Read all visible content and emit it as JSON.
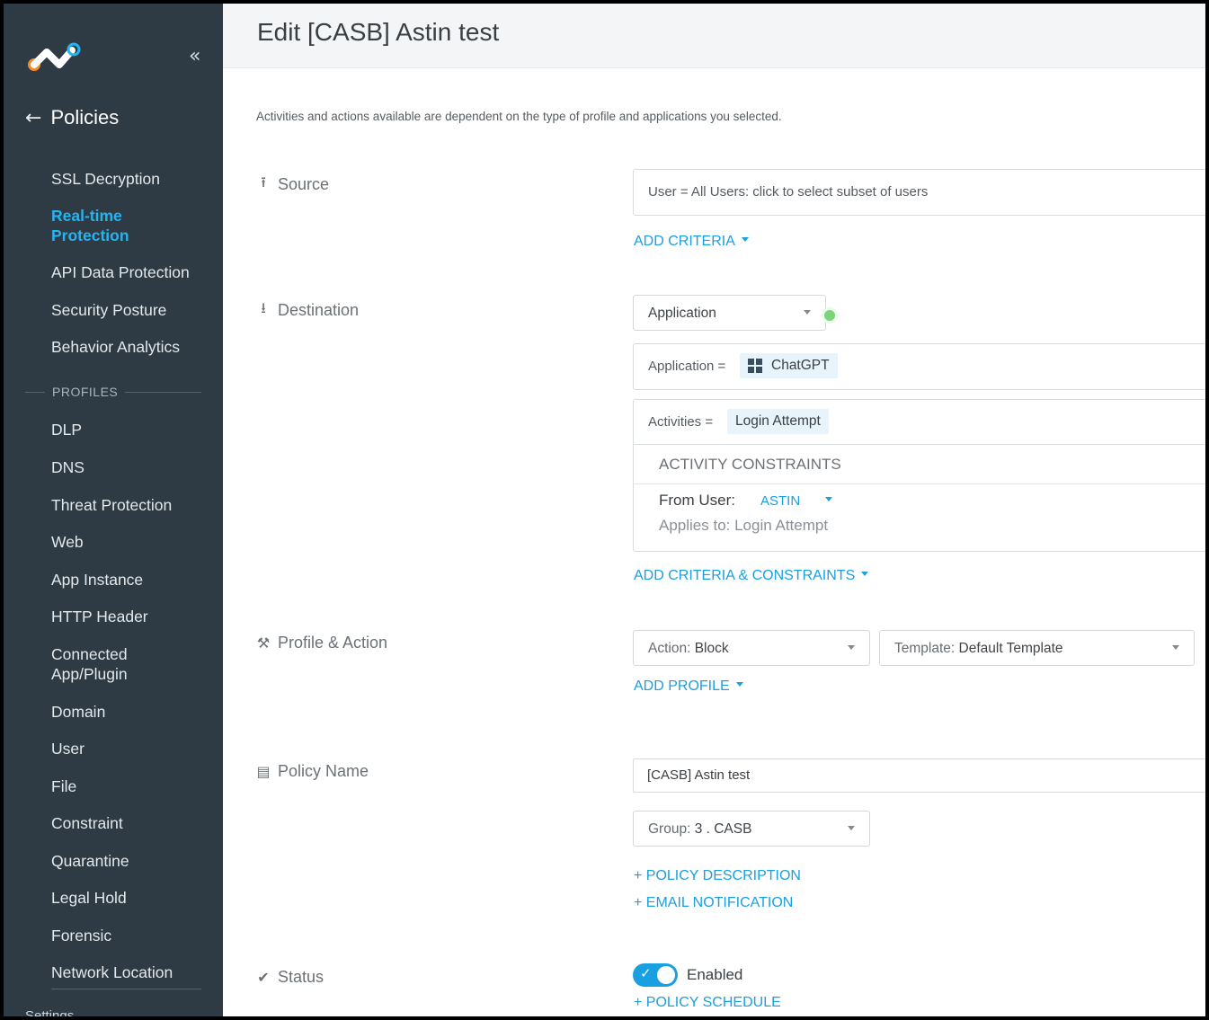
{
  "sidebar": {
    "collapse_icon": "double-chevron-left-icon",
    "back_icon": "arrow-left-icon",
    "title": "Policies",
    "items": [
      {
        "label": "SSL Decryption"
      },
      {
        "label": "Real-time Protection",
        "active": true
      },
      {
        "label": "API Data Protection"
      },
      {
        "label": "Security Posture"
      },
      {
        "label": "Behavior Analytics"
      }
    ],
    "profiles_heading": "PROFILES",
    "profiles": [
      {
        "label": "DLP"
      },
      {
        "label": "DNS"
      },
      {
        "label": "Threat Protection"
      },
      {
        "label": "Web"
      },
      {
        "label": "App Instance"
      },
      {
        "label": "HTTP Header"
      },
      {
        "label": "Connected App/Plugin"
      },
      {
        "label": "Domain"
      },
      {
        "label": "User"
      },
      {
        "label": "File"
      },
      {
        "label": "Constraint"
      },
      {
        "label": "Quarantine"
      },
      {
        "label": "Legal Hold"
      },
      {
        "label": "Forensic"
      },
      {
        "label": "Network Location"
      }
    ],
    "cut_off_item": "Settings",
    "accent_color": "#25b4f0",
    "background_color": "#2e3b45"
  },
  "header": {
    "title": "Edit [CASB] Astin test"
  },
  "intro_text": "Activities and actions available are dependent on the type of profile and applications you selected.",
  "source": {
    "label": "Source",
    "icon": "upload-icon",
    "user_field": "User = All Users: click to select subset of users",
    "add_criteria": "ADD CRITERIA"
  },
  "destination": {
    "label": "Destination",
    "icon": "download-icon",
    "type_select": "Application",
    "application_prefix": "Application =",
    "application_value": "ChatGPT",
    "activities_prefix": "Activities =",
    "activities_value": "Login Attempt",
    "constraints_heading": "ACTIVITY CONSTRAINTS",
    "from_user_label": "From User:",
    "from_user_value": "ASTIN",
    "applies_to": "Applies to: Login Attempt",
    "add_criteria_constraints": "ADD CRITERIA & CONSTRAINTS"
  },
  "profile_action": {
    "label": "Profile & Action",
    "icon": "gavel-icon",
    "action_label": "Action:",
    "action_value": "Block",
    "template_label": "Template:",
    "template_value": "Default Template",
    "add_profile": "ADD PROFILE"
  },
  "policy_name": {
    "label": "Policy Name",
    "icon": "document-icon",
    "value": "[CASB] Astin test",
    "group_label": "Group:",
    "group_value": "3 . CASB",
    "policy_description": "+ POLICY DESCRIPTION",
    "email_notification": "+ EMAIL NOTIFICATION"
  },
  "status": {
    "label": "Status",
    "icon": "check-circle-icon",
    "enabled": true,
    "enabled_label": "Enabled",
    "policy_schedule": "+ POLICY SCHEDULE"
  },
  "colors": {
    "link": "#1a9fe0",
    "status_dot": "#7bd477"
  }
}
